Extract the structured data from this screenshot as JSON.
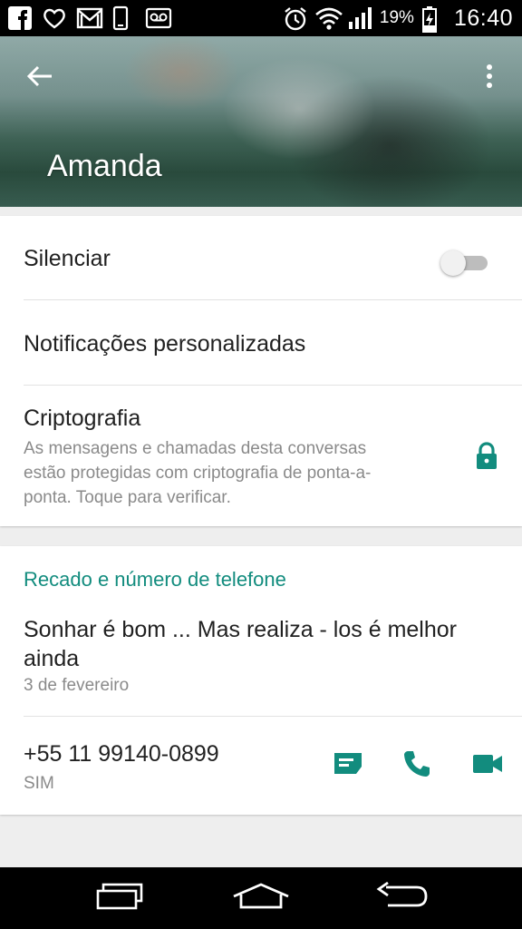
{
  "status_bar": {
    "left_icons": [
      "facebook-icon",
      "heart-icon",
      "gmail-icon",
      "phone-icon",
      "voicemail-icon"
    ],
    "right_icons": [
      "alarm-icon",
      "wifi-icon",
      "signal-icon",
      "battery-charging-icon"
    ],
    "battery": "19%",
    "time": "16:40"
  },
  "header": {
    "contact_name": "Amanda"
  },
  "settings": {
    "mute_label": "Silenciar",
    "mute_on": false,
    "custom_notifications_label": "Notificações personalizadas",
    "encryption_title": "Criptografia",
    "encryption_line1": "As mensagens e chamadas desta conversas",
    "encryption_line2": "estão protegidas com criptografia de ponta-a-",
    "encryption_line3": "ponta. Toque para verificar."
  },
  "about": {
    "section_title": "Recado e número de telefone",
    "status_line1": "Sonhar é bom ... Mas realiza - los é melhor",
    "status_line2": "ainda",
    "status_date": "3 de fevereiro",
    "phone_number": "+55 11 99140-0899",
    "phone_type": "SIM"
  },
  "colors": {
    "accent": "#128c7e",
    "status_bar": "#000000",
    "nav_bar": "#000000"
  }
}
